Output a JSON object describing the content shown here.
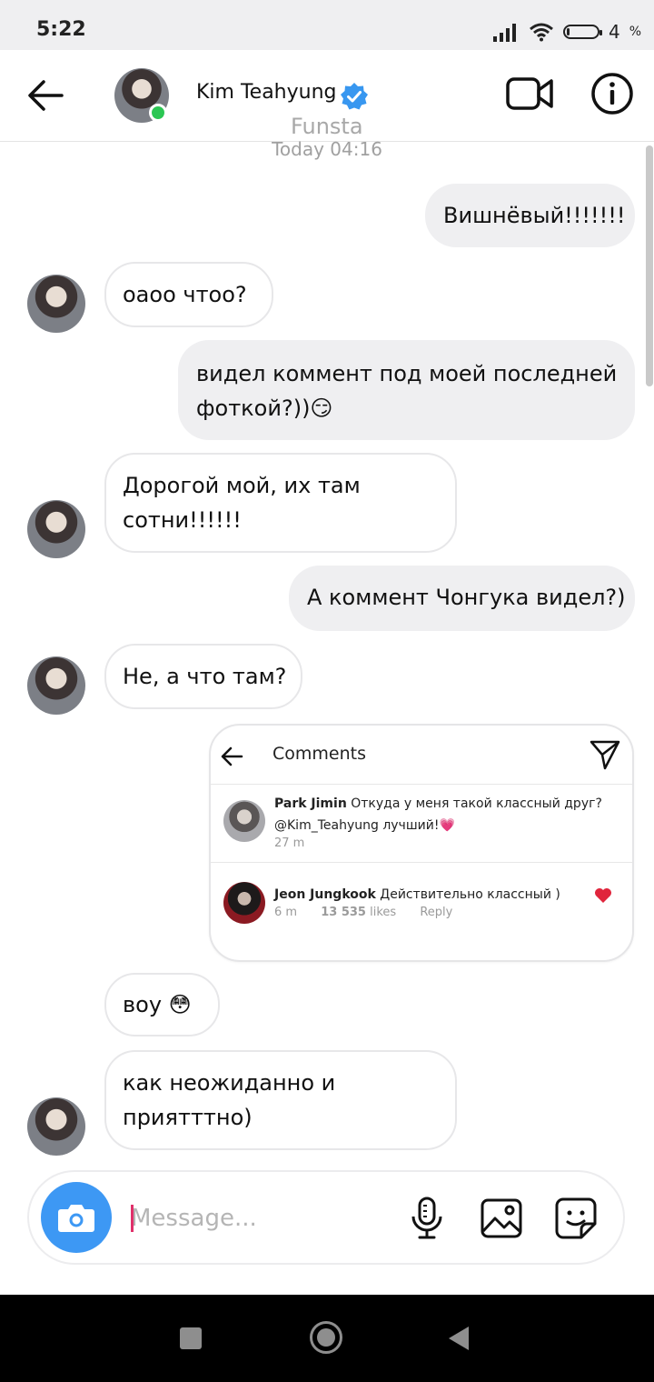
{
  "status_bar": {
    "time": "5:22",
    "battery_level": "4",
    "battery_unit": "%",
    "battery_fraction": 0.04
  },
  "header": {
    "contact_name": "Kim Teahyung",
    "subtitle": "Funsta",
    "online": true,
    "icons": {
      "back": "arrow-left-icon",
      "verified": "verified-badge-icon",
      "video": "video-camera-icon",
      "info": "info-icon"
    }
  },
  "chat": {
    "timestamp": "Today 04:16",
    "messages": [
      {
        "from": "me",
        "text": "Вишнёвый!!!!!!!"
      },
      {
        "from": "them",
        "text": "оаоо чтоо?"
      },
      {
        "from": "me",
        "lines": [
          "видел коммент под моей последней",
          "фоткой?))😏"
        ]
      },
      {
        "from": "them",
        "lines": [
          "Дорогой мой, их там",
          "сотни!!!!!!"
        ]
      },
      {
        "from": "me",
        "text": "А коммент Чонгука видел?)"
      },
      {
        "from": "them",
        "text": "Не, а что там?"
      },
      {
        "from": "them",
        "text": "воу 😳"
      },
      {
        "from": "them",
        "lines": [
          "как неожиданно и",
          "приятттно)"
        ]
      }
    ],
    "shared_card": {
      "title": "Comments",
      "comments": [
        {
          "author": "Park Jimin",
          "text_line1": "Откуда у меня такой классный друг?",
          "text_line2": "@Kim_Teahyung лучший!💗",
          "time": "27 m"
        },
        {
          "author": "Jeon Jungkook",
          "text_line1": "Действительно классный )",
          "time": "6 m",
          "likes": "13 535",
          "likes_label": "likes",
          "reply": "Reply",
          "liked": true
        }
      ]
    }
  },
  "composer": {
    "placeholder": "Message...",
    "icons": {
      "camera": "camera-icon",
      "mic": "microphone-icon",
      "gallery": "image-icon",
      "sticker": "sticker-icon"
    }
  },
  "colors": {
    "accent": "#3d98f4",
    "online": "#2bc653",
    "heart": "#e0253c",
    "bubble_out": "#efeff1"
  }
}
